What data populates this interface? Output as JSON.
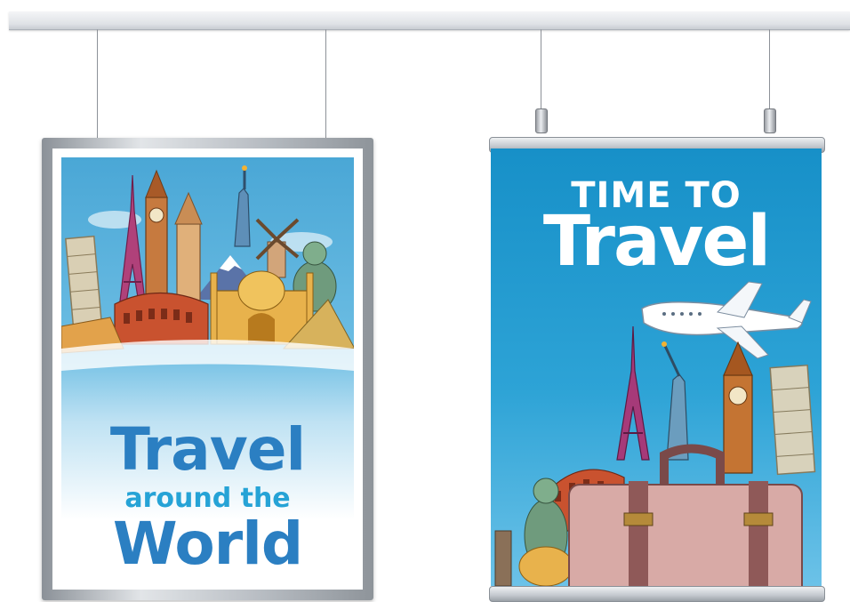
{
  "left_poster": {
    "title": "Travel",
    "subtitle": "around the",
    "title2": "World"
  },
  "right_poster": {
    "heading_small": "TIME TO",
    "heading_big": "Travel"
  },
  "colors": {
    "rail": "#dfe2e6",
    "left_sky": "#4aa7d6",
    "left_title": "#2b7fc2",
    "left_subtitle": "#26a3d6",
    "right_sky": "#1790c8",
    "suitcase": "#d8aaa6",
    "strap": "#7a4a49"
  }
}
